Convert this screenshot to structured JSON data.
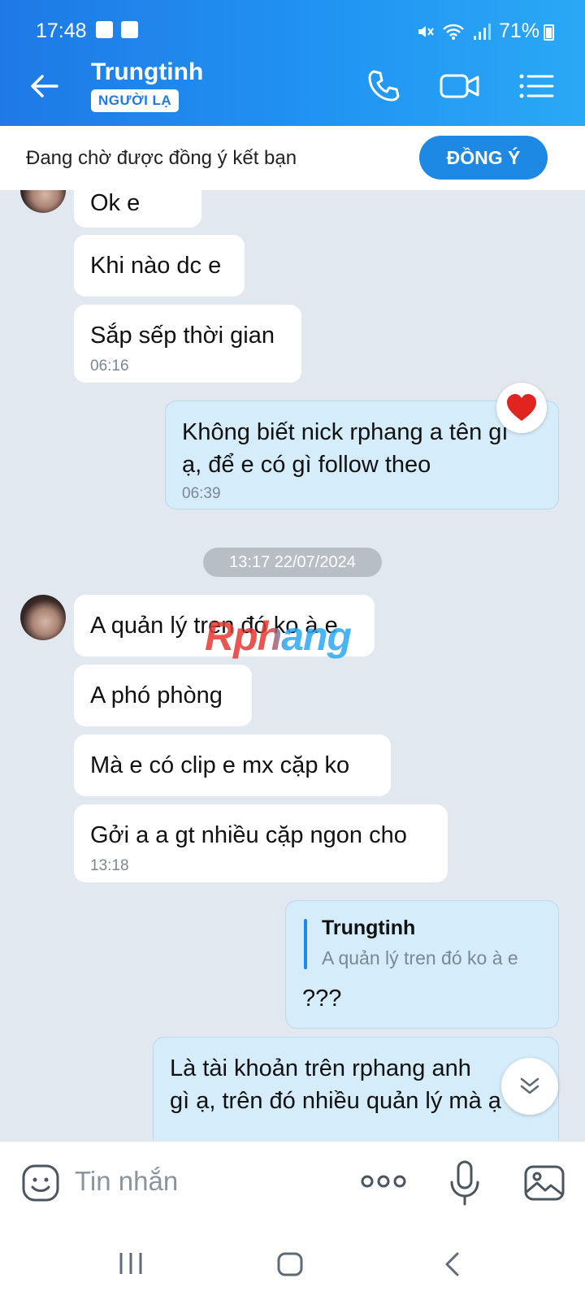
{
  "status_bar": {
    "time": "17:48",
    "battery": "71%"
  },
  "header": {
    "contact_name": "Trungtinh",
    "badge": "NGƯỜI LẠ"
  },
  "friend_request": {
    "text": "Đang chờ được đồng ý kết bạn",
    "button": "ĐỒNG Ý"
  },
  "messages": {
    "m1": "Ok e",
    "m2": "Khi nào dc e",
    "m3": "Sắp sếp thời gian",
    "m3_time": "06:16",
    "m4_line1": "Không biết nick rphang a tên gì",
    "m4_line2": "ạ, để e có gì follow theo",
    "m4_time": "06:39",
    "date_divider": "13:17 22/07/2024",
    "m5": "A quản lý tren đó ko à e",
    "m6": "A phó phòng",
    "m7": "Mà e có clip e mx cặp ko",
    "m8": "Gởi a a gt nhiều cặp ngon cho",
    "m8_time": "13:18",
    "reply_author": "Trungtinh",
    "reply_quote": "A quản lý tren đó ko à e",
    "reply_text": "???",
    "m10_line1": "Là tài khoản trên rphang anh",
    "m10_line2": "gì ạ, trên đó nhiều quản lý mà ạ"
  },
  "watermark": "Rphang",
  "input": {
    "placeholder": "Tin nhắn"
  }
}
